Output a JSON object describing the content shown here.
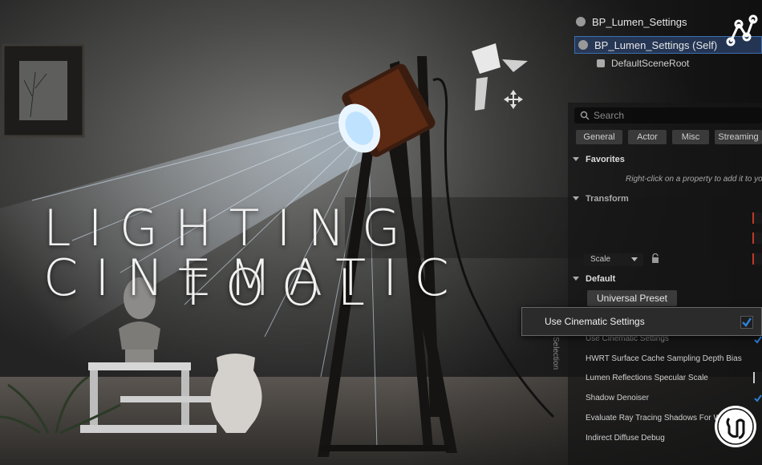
{
  "title": {
    "line1": "LIGHTING CINEMATIC",
    "line2": "TOOL"
  },
  "outliner": {
    "blueprint": "BP_Lumen_Settings",
    "self": "BP_Lumen_Settings (Self)",
    "root": "DefaultSceneRoot"
  },
  "details": {
    "search_placeholder": "Search",
    "tabs": [
      "General",
      "Actor",
      "Misc",
      "Streaming"
    ],
    "sections": {
      "favorites": "Favorites",
      "transform": "Transform",
      "default": "Default"
    },
    "favorites_hint": "Right-click on a property to add it to your",
    "scale_dropdown": "Scale",
    "preset_button": "Universal Preset",
    "use_cinematic": {
      "label": "Use Cinematic Settings",
      "checked": true
    },
    "properties": [
      {
        "label": "Use Cinematic Settings",
        "checked": true
      },
      {
        "label": "HWRT Surface Cache Sampling Depth Bias"
      },
      {
        "label": "Lumen Reflections Specular Scale"
      },
      {
        "label": "Shadow Denoiser",
        "checked": true
      },
      {
        "label": "Evaluate Ray Tracing Shadows For WPO F"
      },
      {
        "label": "Indirect Diffuse Debug"
      }
    ],
    "side_label": "Selection"
  },
  "colors": {
    "accent": "#2f7fd8",
    "selection": "#3c6fb0",
    "field_red": "#c0392b"
  },
  "icons": [
    "search-icon",
    "graph-icon",
    "lock-icon",
    "checkbox-checked-icon",
    "unreal-logo-icon",
    "light-gizmo-icon"
  ]
}
